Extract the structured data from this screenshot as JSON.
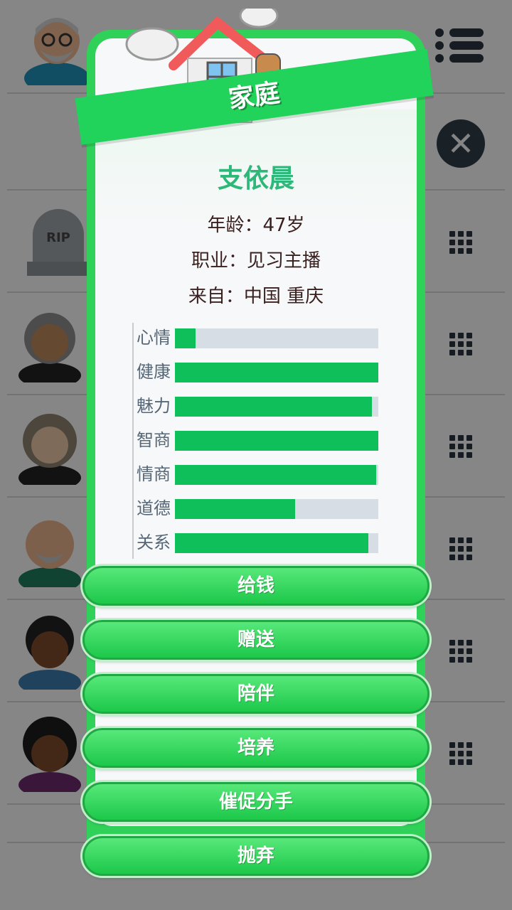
{
  "modal": {
    "title": "家庭",
    "person": {
      "name": "支依晨",
      "age_label": "年龄：",
      "age_value": "47岁",
      "job_label": "职业：",
      "job_value": "见习主播",
      "origin_label": "来自：",
      "origin_value": "中国 重庆"
    },
    "stats": [
      {
        "label": "心情",
        "value": 0.1
      },
      {
        "label": "健康",
        "value": 1.0
      },
      {
        "label": "魅力",
        "value": 0.97
      },
      {
        "label": "智商",
        "value": 1.0
      },
      {
        "label": "情商",
        "value": 0.99
      },
      {
        "label": "道德",
        "value": 0.59
      },
      {
        "label": "关系",
        "value": 0.95
      }
    ],
    "actions": [
      "给钱",
      "赠送",
      "陪伴",
      "培养",
      "催促分手",
      "抛弃"
    ]
  },
  "background": {
    "rip_text": "RIP"
  },
  "colors": {
    "accent_green": "#2fd159",
    "bar_fill": "#0fbf5a",
    "bar_track": "#d6dde4",
    "name_color": "#2db87a"
  },
  "icons": [
    "menu-icon",
    "close-icon",
    "grid-icon",
    "house-icon"
  ]
}
